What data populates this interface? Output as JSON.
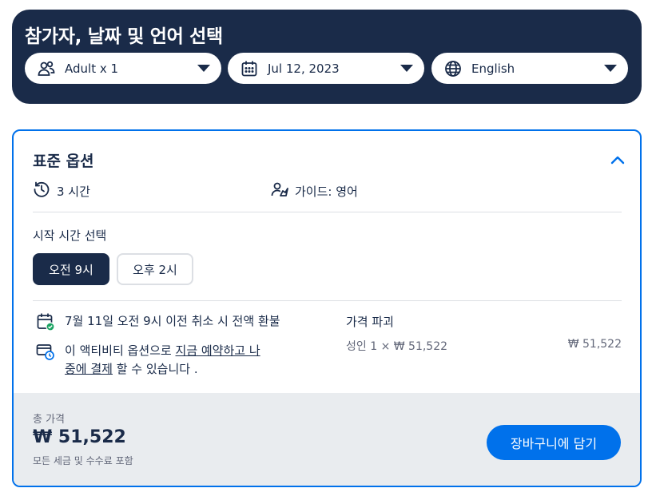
{
  "header": {
    "title": "참가자, 날짜 및 언어 선택",
    "participants": {
      "label": "Adult x 1",
      "icon": "people-icon"
    },
    "date": {
      "label": "Jul 12, 2023",
      "icon": "calendar-icon"
    },
    "language": {
      "label": "English",
      "icon": "globe-icon"
    }
  },
  "option": {
    "title": "표준 옵션",
    "duration": "3 시간",
    "guide": "가이드: 영어",
    "start_time_label": "시작 시간 선택",
    "times": [
      {
        "label": "오전 9시",
        "selected": true
      },
      {
        "label": "오후 2시",
        "selected": false
      }
    ],
    "cancellation": "7월 11일 오전 9시 이전 취소 시 전액 환불",
    "reserve_prefix": "이 액티비티 옵션으로 ",
    "reserve_link1": "지금 예약하고 나",
    "reserve_link2": "중에 결제",
    "reserve_suffix": " 할 수 있습니다 .",
    "price_breakdown_title": "가격 파괴",
    "price_line_label": "성인 1 × ₩ 51,522",
    "price_line_value": "₩ 51,522"
  },
  "footer": {
    "total_label": "총 가격",
    "total_price": "₩ 51,522",
    "tax_note": "모든 세금 및 수수료 포함",
    "cart_button": "장바구니에 담기"
  },
  "colors": {
    "navy": "#1a2b49",
    "accent": "#0071eb",
    "success": "#1ba362",
    "footer_bg": "#e9ecef"
  }
}
